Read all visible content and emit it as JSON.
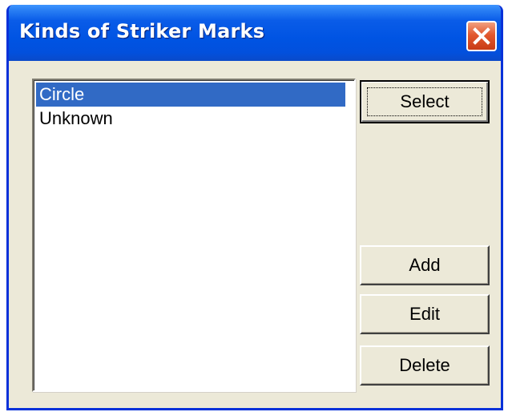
{
  "window": {
    "title": "Kinds of Striker Marks"
  },
  "titlebar": {
    "close_icon": "close-icon",
    "colors": {
      "titlebar": "#0054e3",
      "close_button": "#e2582e",
      "selection": "#316ac5",
      "dialog_face": "#ece9d8"
    }
  },
  "list": {
    "items": [
      {
        "label": "Circle",
        "selected": true
      },
      {
        "label": "Unknown",
        "selected": false
      }
    ]
  },
  "buttons": {
    "select_label": "Select",
    "add_label": "Add",
    "edit_label": "Edit",
    "delete_label": "Delete"
  }
}
